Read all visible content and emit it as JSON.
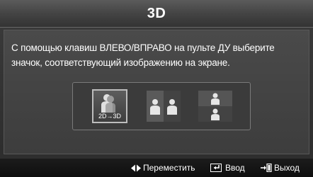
{
  "dialog": {
    "title": "3D",
    "message": "С помощью клавиш ВЛЕВО/ВПРАВО на пульте ДУ выберите значок, соответствующий изображению на экране."
  },
  "modes": [
    {
      "id": "2d-to-3d",
      "label": "2D→3D",
      "selected": true,
      "icon": "2d-to-3d-person-icon"
    },
    {
      "id": "side-by-side",
      "label": "",
      "selected": false,
      "icon": "side-by-side-icon"
    },
    {
      "id": "top-bottom",
      "label": "",
      "selected": false,
      "icon": "top-bottom-icon"
    }
  ],
  "footer": {
    "move_label": "Переместить",
    "enter_label": "Ввод",
    "exit_label": "Выход"
  },
  "colors": {
    "accent": "#bdbdbd",
    "text": "#ffffff",
    "background": "#3a3a3a"
  }
}
